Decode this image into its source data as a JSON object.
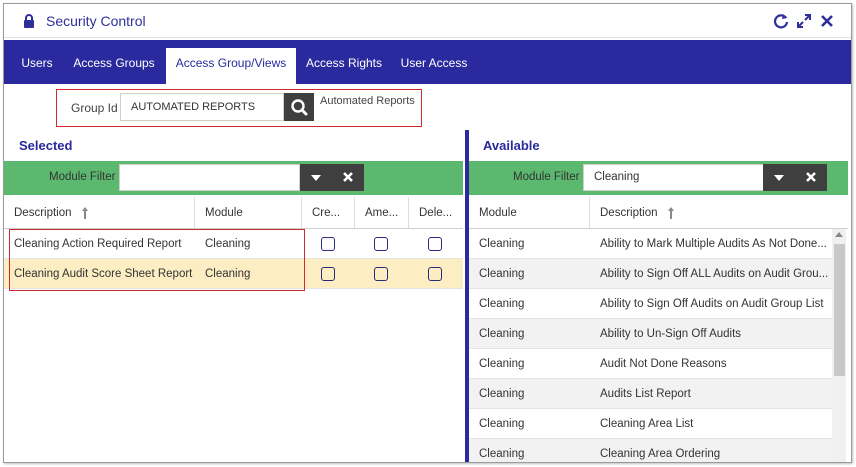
{
  "window": {
    "title": "Security Control"
  },
  "tabs": [
    {
      "label": "Users"
    },
    {
      "label": "Access Groups"
    },
    {
      "label": "Access Group/Views",
      "active": true
    },
    {
      "label": "Access Rights"
    },
    {
      "label": "User Access"
    }
  ],
  "group": {
    "label": "Group Id",
    "value": "AUTOMATED REPORTS",
    "description": "Automated Reports"
  },
  "selected": {
    "title": "Selected",
    "filter_label": "Module Filter",
    "filter_value": "",
    "columns": [
      "Description",
      "Module",
      "Cre...",
      "Ame...",
      "Dele..."
    ],
    "rows": [
      {
        "description": "Cleaning Action Required Report",
        "module": "Cleaning",
        "create": false,
        "amend": false,
        "delete": false
      },
      {
        "description": "Cleaning Audit Score Sheet Report",
        "module": "Cleaning",
        "create": false,
        "amend": false,
        "delete": false,
        "highlighted": true
      }
    ]
  },
  "available": {
    "title": "Available",
    "filter_label": "Module Filter",
    "filter_value": "Cleaning",
    "columns": [
      "Module",
      "Description"
    ],
    "rows": [
      {
        "module": "Cleaning",
        "description": "Ability to Mark Multiple Audits As Not Done..."
      },
      {
        "module": "Cleaning",
        "description": "Ability to Sign Off ALL Audits on Audit Grou..."
      },
      {
        "module": "Cleaning",
        "description": "Ability to Sign Off Audits on Audit Group List"
      },
      {
        "module": "Cleaning",
        "description": "Ability to Un-Sign Off Audits"
      },
      {
        "module": "Cleaning",
        "description": "Audit Not Done Reasons"
      },
      {
        "module": "Cleaning",
        "description": "Audits List Report"
      },
      {
        "module": "Cleaning",
        "description": "Cleaning Area List"
      },
      {
        "module": "Cleaning",
        "description": "Cleaning Area Ordering"
      }
    ]
  },
  "colors": {
    "accent": "#2a2a9e",
    "filter_bar": "#5bb86e",
    "highlight_row": "#fdedc2",
    "annotation_red": "#d12a2a",
    "dark_button": "#3f3f3f"
  },
  "icons": [
    "lock-icon",
    "refresh-icon",
    "expand-icon",
    "close-icon",
    "search-icon",
    "chevron-down-icon",
    "clear-icon",
    "sort-up-icon"
  ]
}
